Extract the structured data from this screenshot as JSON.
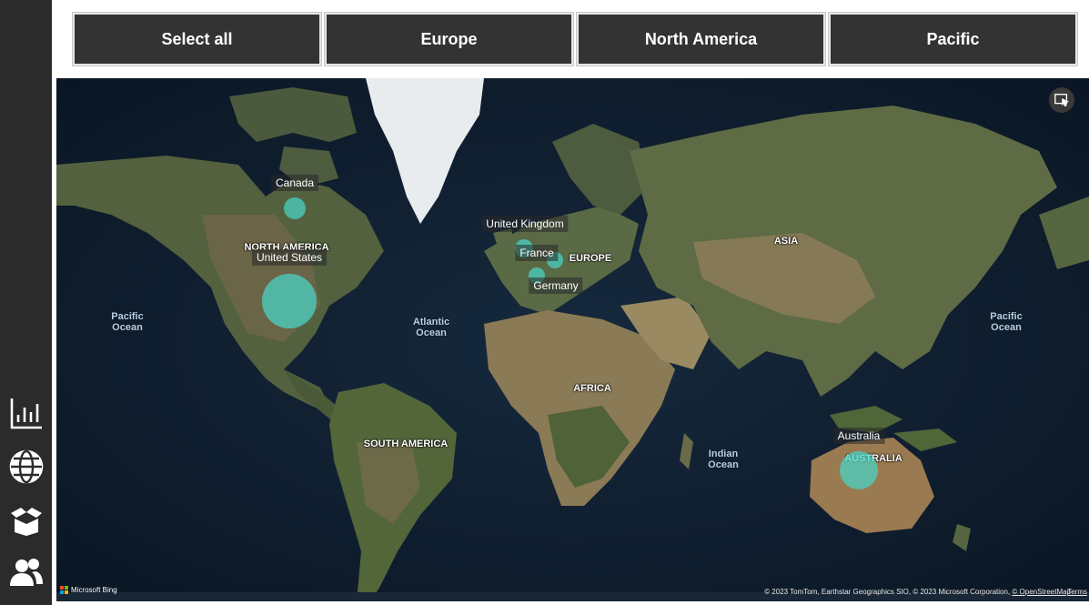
{
  "slicer": {
    "buttons": [
      {
        "label": "Select all"
      },
      {
        "label": "Europe"
      },
      {
        "label": "North America"
      },
      {
        "label": "Pacific"
      }
    ]
  },
  "nav": {
    "icons": [
      "bar-chart-icon",
      "globe-icon",
      "box-icon",
      "users-icon"
    ]
  },
  "map": {
    "region_labels": {
      "north_america": "NORTH AMERICA",
      "south_america": "SOUTH AMERICA",
      "europe": "EUROPE",
      "africa": "AFRICA",
      "asia": "ASIA",
      "australia": "AUSTRALIA"
    },
    "ocean_labels": {
      "pacific_left": "Pacific\nOcean",
      "pacific_right": "Pacific\nOcean",
      "atlantic": "Atlantic\nOcean",
      "indian": "Indian\nOcean"
    },
    "bubbles": [
      {
        "country": "Canada",
        "size": "small"
      },
      {
        "country": "United States",
        "size": "large"
      },
      {
        "country": "United Kingdom",
        "size": "small"
      },
      {
        "country": "France",
        "size": "small"
      },
      {
        "country": "Germany",
        "size": "small"
      },
      {
        "country": "Australia",
        "size": "medium"
      }
    ],
    "provider": "Microsoft Bing",
    "attribution": "© 2023 TomTom, Earthstar Geographics SIO, © 2023 Microsoft Corporation,",
    "attribution_link": "© OpenStreetMap",
    "terms": "Terms"
  },
  "colors": {
    "bubble": "#48d6c8",
    "button_bg": "#333333",
    "rail_bg": "#2b2b2b"
  }
}
